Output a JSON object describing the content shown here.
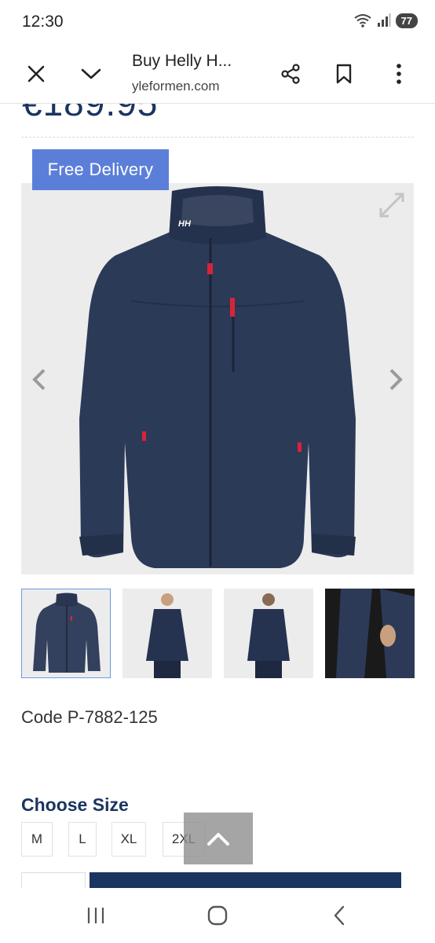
{
  "status_bar": {
    "time": "12:30",
    "battery": "77",
    "icons": [
      "wifi-icon",
      "signal-icon",
      "battery-icon"
    ]
  },
  "browser": {
    "title": "Buy Helly H...",
    "url": "yleformen.com",
    "icons": [
      "close-icon",
      "chevron-down-icon",
      "share-icon",
      "bookmark-icon",
      "more-vertical-icon"
    ]
  },
  "product": {
    "price": "€189.95",
    "badge": "Free Delivery",
    "code": "Code P-7882-125",
    "jacket_logo": "HH",
    "choose_size_label": "Choose Size",
    "sizes": [
      "M",
      "L",
      "XL",
      "2XL"
    ]
  },
  "colors": {
    "brand_navy": "#1a3560",
    "badge_blue": "#5b7fd9",
    "jacket_navy": "#2b3a57",
    "zipper_red": "#d6243a"
  },
  "nav_bar": {
    "icons": [
      "recent-apps-icon",
      "home-icon",
      "back-icon"
    ]
  }
}
